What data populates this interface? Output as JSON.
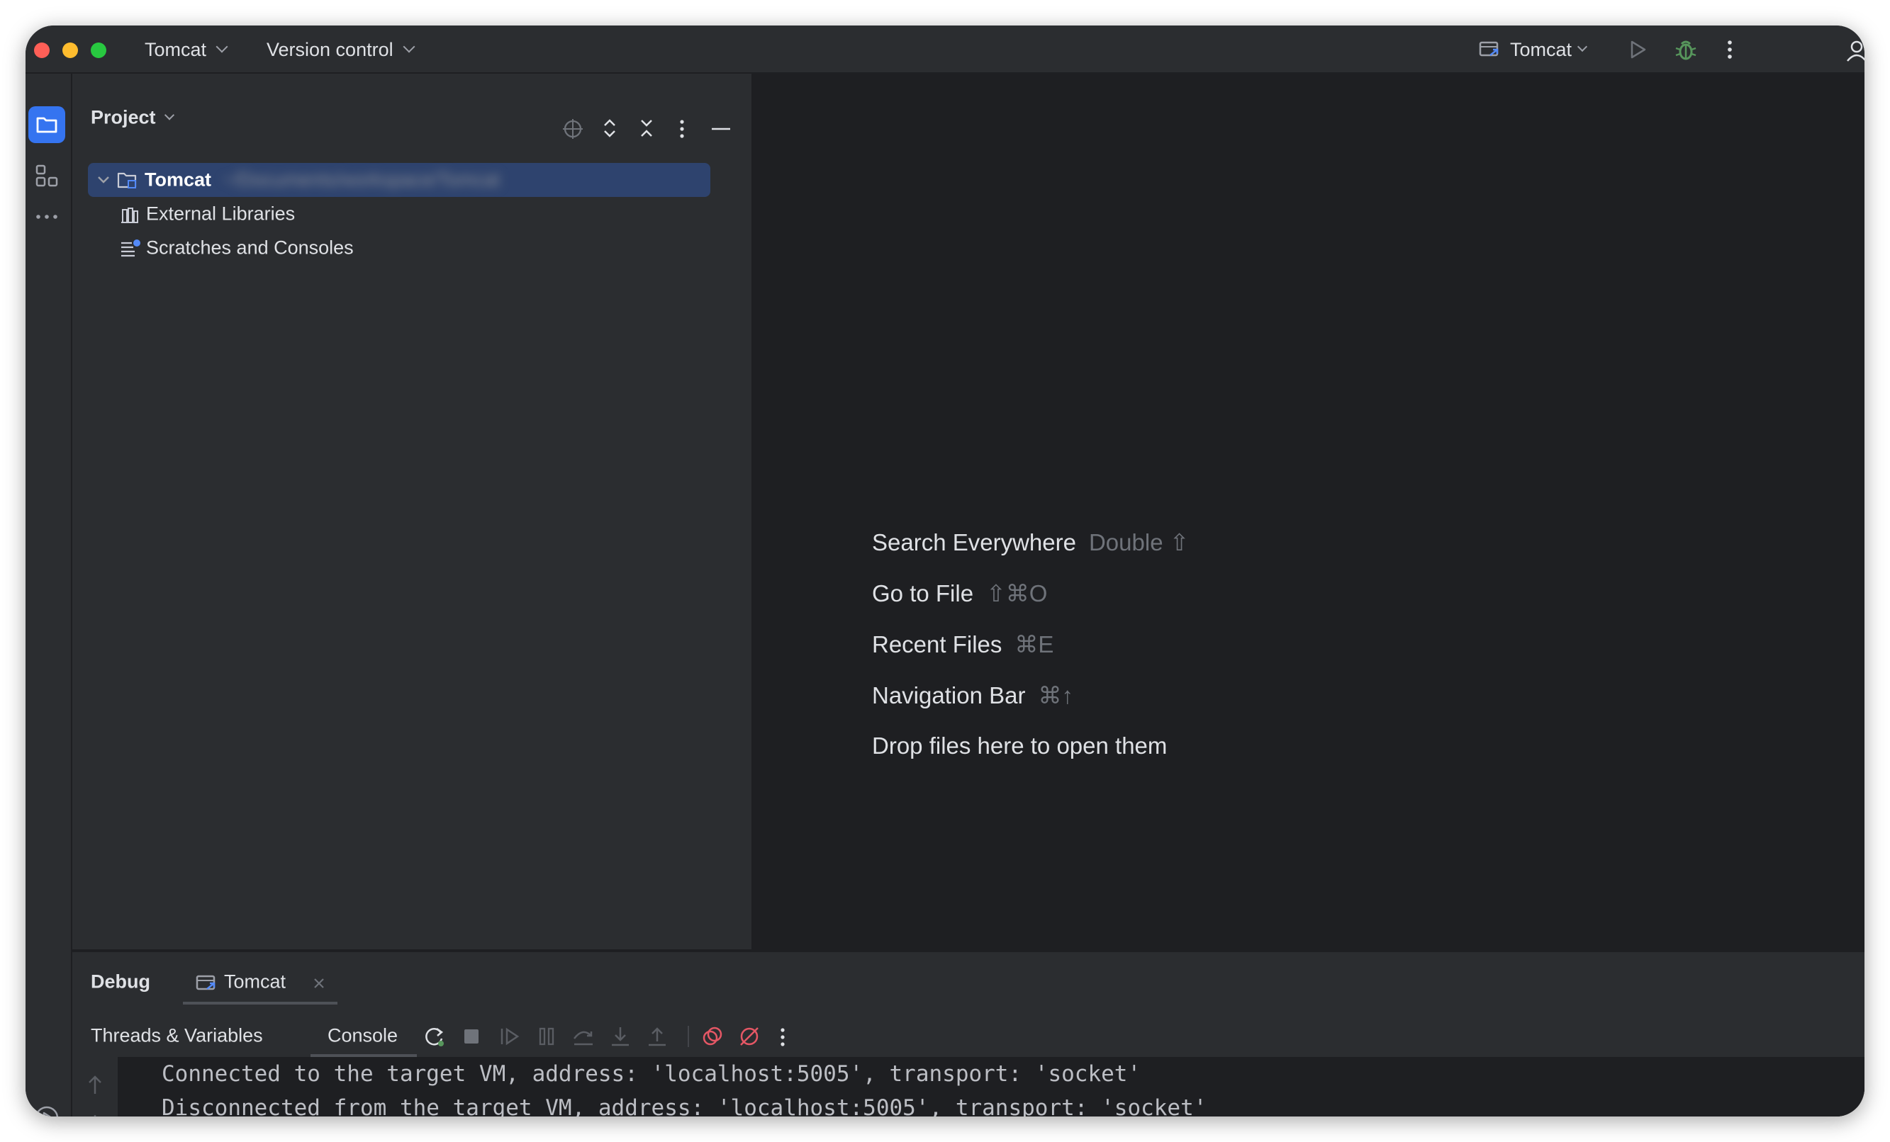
{
  "titlebar": {
    "project_name": "Tomcat",
    "vcs_label": "Version control",
    "run_config": "Tomcat"
  },
  "project_panel": {
    "title": "Project",
    "tree": [
      {
        "label": "Tomcat",
        "path_hint": "~/Documents/workspace/Tomcat"
      },
      {
        "label": "External Libraries"
      },
      {
        "label": "Scratches and Consoles"
      }
    ]
  },
  "editor": {
    "hints": [
      {
        "action": "Search Everywhere",
        "shortcut": "Double ⇧"
      },
      {
        "action": "Go to File",
        "shortcut": "⇧⌘O"
      },
      {
        "action": "Recent Files",
        "shortcut": "⌘E"
      },
      {
        "action": "Navigation Bar",
        "shortcut": "⌘↑"
      },
      {
        "action": "Drop files here to open them",
        "shortcut": ""
      }
    ]
  },
  "debug": {
    "title": "Debug",
    "session_tab": "Tomcat",
    "tabs": [
      "Threads & Variables",
      "Console"
    ],
    "console_lines": [
      "Connected to the target VM, address: 'localhost:5005', transport: 'socket'",
      "Disconnected from the target VM, address: 'localhost:5005', transport: 'socket'"
    ]
  },
  "colors": {
    "accent": "#3574f0",
    "debug_green": "#57965c",
    "breakpoint_red": "#e55765",
    "selection": "#2e436e"
  }
}
